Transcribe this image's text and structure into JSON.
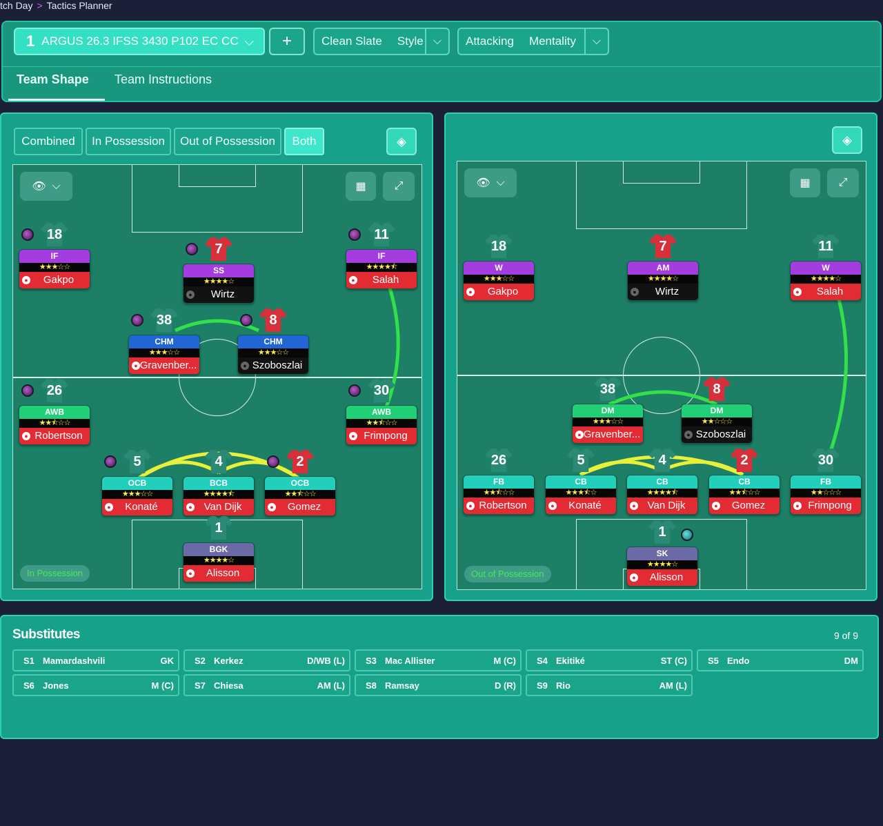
{
  "breadcrumb": {
    "first": "tch Day",
    "second": "Tactics Planner"
  },
  "toolbar": {
    "tactic_number": "1",
    "tactic_name": "ARGUS 26.3 IFSS 3430 P102 EC CC",
    "add_label": "+",
    "style_value": "Clean Slate",
    "style_label": "Style",
    "mentality_value": "Attacking",
    "mentality_label": "Mentality"
  },
  "tabs": {
    "team_shape": "Team Shape",
    "team_instructions": "Team Instructions"
  },
  "view_toggle": {
    "combined": "Combined",
    "in_possession": "In Possession",
    "out_of_possession": "Out of Possession",
    "both": "Both",
    "selected": "Both"
  },
  "left_pitch": {
    "legend": "In Possession",
    "players": [
      {
        "id": "lp-gakpo",
        "num": "18",
        "role": "IF",
        "stars": "★★★☆☆",
        "name": "Gakpo",
        "role_color": "purple",
        "shirt": "gray",
        "mood": true
      },
      {
        "id": "lp-wirtz",
        "num": "7",
        "role": "SS",
        "stars": "★★★★☆",
        "name": "Wirtz",
        "role_color": "purple",
        "shirt": "red",
        "mood": true,
        "dark": true
      },
      {
        "id": "lp-salah",
        "num": "11",
        "role": "IF",
        "stars": "★★★★⯪",
        "name": "Salah",
        "role_color": "purple",
        "shirt": "gray",
        "mood": true
      },
      {
        "id": "lp-grav",
        "num": "38",
        "role": "CHM",
        "stars": "★★★☆☆",
        "name": "Gravenber...",
        "role_color": "blue",
        "shirt": "gray",
        "mood": true
      },
      {
        "id": "lp-szob",
        "num": "8",
        "role": "CHM",
        "stars": "★★★☆☆",
        "name": "Szoboszlai",
        "role_color": "blue",
        "shirt": "red",
        "mood": true,
        "dark": true
      },
      {
        "id": "lp-rob",
        "num": "26",
        "role": "AWB",
        "stars": "★★⯪☆☆",
        "name": "Robertson",
        "role_color": "green",
        "shirt": "gray",
        "mood": true
      },
      {
        "id": "lp-frim",
        "num": "30",
        "role": "AWB",
        "stars": "★★⯪☆☆",
        "name": "Frimpong",
        "role_color": "green",
        "shirt": "gray",
        "mood": true
      },
      {
        "id": "lp-kon",
        "num": "5",
        "role": "OCB",
        "stars": "★★★☆☆",
        "name": "Konaté",
        "role_color": "teal",
        "shirt": "gray",
        "mood": true
      },
      {
        "id": "lp-vvd",
        "num": "4",
        "role": "BCB",
        "stars": "★★★★⯪",
        "name": "Van Dijk",
        "role_color": "teal",
        "shirt": "gray",
        "mood": false
      },
      {
        "id": "lp-gom",
        "num": "2",
        "role": "OCB",
        "stars": "★★⯪☆☆",
        "name": "Gomez",
        "role_color": "teal",
        "shirt": "red",
        "mood": true
      },
      {
        "id": "lp-ali",
        "num": "1",
        "role": "BGK",
        "stars": "★★★★☆",
        "name": "Alisson",
        "role_color": "slate",
        "shirt": "gray",
        "mood": false
      }
    ]
  },
  "right_pitch": {
    "legend": "Out of Possession",
    "players": [
      {
        "id": "rp-gakpo",
        "num": "18",
        "role": "W",
        "stars": "★★★☆☆",
        "name": "Gakpo",
        "role_color": "purple",
        "shirt": "gray"
      },
      {
        "id": "rp-wirtz",
        "num": "7",
        "role": "AM",
        "stars": "★★★★☆",
        "name": "Wirtz",
        "role_color": "purple",
        "shirt": "red",
        "dark": true
      },
      {
        "id": "rp-salah",
        "num": "11",
        "role": "W",
        "stars": "★★★★☆",
        "name": "Salah",
        "role_color": "purple",
        "shirt": "gray"
      },
      {
        "id": "rp-grav",
        "num": "38",
        "role": "DM",
        "stars": "★★★☆☆",
        "name": "Gravenber...",
        "role_color": "green",
        "shirt": "gray"
      },
      {
        "id": "rp-szob",
        "num": "8",
        "role": "DM",
        "stars": "★★☆☆☆",
        "name": "Szoboszlai",
        "role_color": "green",
        "shirt": "red",
        "dark": true
      },
      {
        "id": "rp-rob",
        "num": "26",
        "role": "FB",
        "stars": "★★⯪☆☆",
        "name": "Robertson",
        "role_color": "teal",
        "shirt": "gray"
      },
      {
        "id": "rp-kon",
        "num": "5",
        "role": "CB",
        "stars": "★★★⯪☆",
        "name": "Konaté",
        "role_color": "teal",
        "shirt": "gray"
      },
      {
        "id": "rp-vvd",
        "num": "4",
        "role": "CB",
        "stars": "★★★★⯪",
        "name": "Van Dijk",
        "role_color": "teal",
        "shirt": "gray"
      },
      {
        "id": "rp-gom",
        "num": "2",
        "role": "CB",
        "stars": "★★⯪☆☆",
        "name": "Gomez",
        "role_color": "teal",
        "shirt": "red"
      },
      {
        "id": "rp-frim",
        "num": "30",
        "role": "FB",
        "stars": "★★☆☆☆",
        "name": "Frimpong",
        "role_color": "teal",
        "shirt": "gray"
      },
      {
        "id": "rp-ali",
        "num": "1",
        "role": "SK",
        "stars": "★★★★☆",
        "name": "Alisson",
        "role_color": "slate",
        "shirt": "gray"
      }
    ]
  },
  "substitutes": {
    "title": "Substitutes",
    "count": "9 of 9",
    "items": [
      {
        "slot": "S1",
        "name": "Mamardashvili",
        "pos": "GK"
      },
      {
        "slot": "S2",
        "name": "Kerkez",
        "pos": "D/WB (L)"
      },
      {
        "slot": "S3",
        "name": "Mac Allister",
        "pos": "M (C)"
      },
      {
        "slot": "S4",
        "name": "Ekitiké",
        "pos": "ST (C)"
      },
      {
        "slot": "S5",
        "name": "Endo",
        "pos": "DM"
      },
      {
        "slot": "S6",
        "name": "Jones",
        "pos": "M (C)"
      },
      {
        "slot": "S7",
        "name": "Chiesa",
        "pos": "AM (L)"
      },
      {
        "slot": "S8",
        "name": "Ramsay",
        "pos": "D (R)"
      },
      {
        "slot": "S9",
        "name": "Rio",
        "pos": "AM (L)"
      }
    ]
  },
  "colors": {
    "background": "#1b1f37",
    "panel": "#18a18a",
    "pitch": "#1d7f66",
    "accent": "#3ee6cb",
    "link_green": "#33e04a",
    "link_yellow": "#e8f03a"
  },
  "icons": {
    "eye": "eye-icon",
    "chevron": "chevron-down-icon",
    "grid": "grid-icon",
    "expand": "expand-icon",
    "diamond": "diamond-icon",
    "person": "player-icon"
  }
}
